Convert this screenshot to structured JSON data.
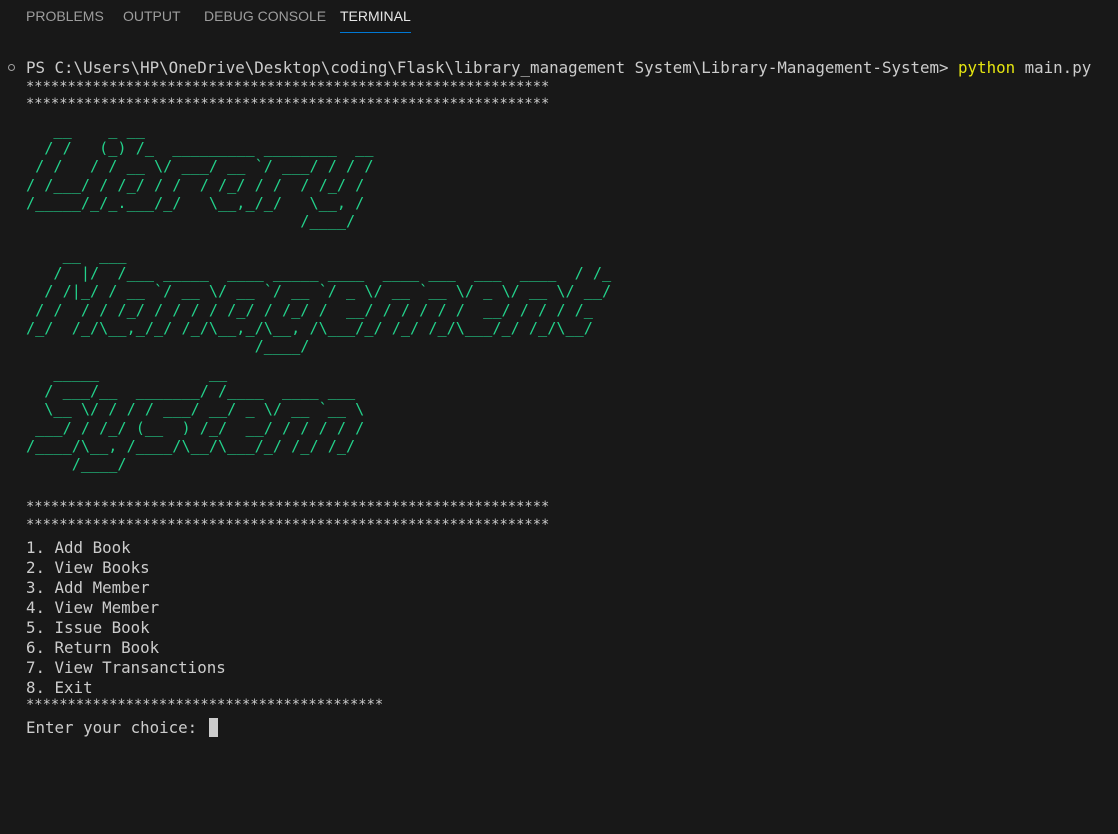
{
  "tabs": [
    {
      "label": "PROBLEMS",
      "active": false
    },
    {
      "label": "OUTPUT",
      "active": false
    },
    {
      "label": "DEBUG CONSOLE",
      "active": false
    },
    {
      "label": "TERMINAL",
      "active": true
    }
  ],
  "terminal": {
    "prompt": "PS C:\\Users\\HP\\OneDrive\\Desktop\\coding\\Flask\\library_management System\\Library-Management-System> ",
    "command_program": "python",
    "command_args": " main.py",
    "stars_long": "***************************************************************",
    "stars_short": "*******************************************",
    "banner_library": "   __    _ __\n  / /   (_) /_  _________ ________  __\n / /   / / __ \\/ ___/ __ `/ ___/ / / /\n/ /___/ / /_/ / /  / /_/ / /  / /_/ /\n/_____/_/_.___/_/   \\__,_/_/   \\__, /\n                              /____/",
    "banner_management": "    __  ___\n   /  |/  /___ _____  ____ _____ ____  ____ ___  ___  ____  / /_\n  / /|_/ / __ `/ __ \\/ __ `/ __ `/ _ \\/ __ `__ \\/ _ \\/ __ \\/ __/\n / /  / / /_/ / / / / /_/ / /_/ /  __/ / / / / /  __/ / / / /_\n/_/  /_/\\__,_/_/ /_/\\__,_/\\__, /\\___/_/ /_/ /_/\\___/_/ /_/\\__/\n                         /____/",
    "banner_system": "   _____            __\n  / ___/__  _______/ /____  ____ ___\n  \\__ \\/ / / / ___/ __/ _ \\/ __ `__ \\\n ___/ / /_/ (__  ) /_/  __/ / / / / /\n/____/\\__, /____/\\__/\\___/_/ /_/ /_/\n     /____/",
    "menu": [
      "1. Add Book",
      "2. View Books",
      "3. Add Member",
      "4. View Member",
      "5. Issue Book",
      "6. Return Book",
      "7. View Transanctions",
      "8. Exit"
    ],
    "input_prompt": "Enter your choice: "
  },
  "colors": {
    "background": "#181818",
    "banner": "#23d18b",
    "command": "#e5e510",
    "tab_active_underline": "#0078d4"
  }
}
